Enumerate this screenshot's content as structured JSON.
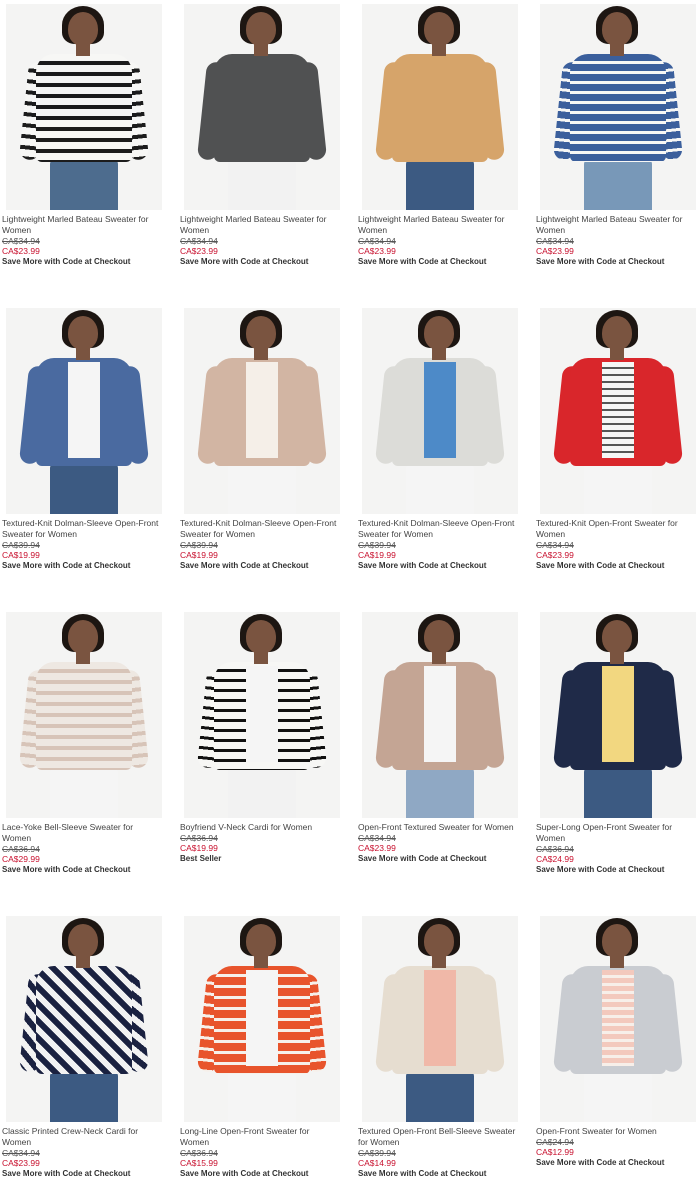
{
  "products": [
    {
      "name": "Lightweight Marled Bateau Sweater for Women",
      "was": "CA$34.94",
      "now": "CA$23.99",
      "promo": "Save More with Code at Checkout",
      "look": {
        "top": "stripe-black",
        "inner": "",
        "legs": "#4d6c8e"
      }
    },
    {
      "name": "Lightweight Marled Bateau Sweater for Women",
      "was": "CA$34.94",
      "now": "CA$23.99",
      "promo": "Save More with Code at Checkout",
      "look": {
        "top": "#505152",
        "inner": "",
        "legs": "#f2f2f2"
      }
    },
    {
      "name": "Lightweight Marled Bateau Sweater for Women",
      "was": "CA$34.94",
      "now": "CA$23.99",
      "promo": "Save More with Code at Checkout",
      "look": {
        "top": "#d6a46a",
        "inner": "",
        "legs": "#3c5a82"
      }
    },
    {
      "name": "Lightweight Marled Bateau Sweater for Women",
      "was": "CA$34.94",
      "now": "CA$23.99",
      "promo": "Save More with Code at Checkout",
      "look": {
        "top": "stripe-blue",
        "inner": "",
        "legs": "#7898b8"
      }
    },
    {
      "name": "Textured-Knit Dolman-Sleeve Open-Front Sweater for Women",
      "was": "CA$39.94",
      "now": "CA$19.99",
      "promo": "Save More with Code at Checkout",
      "look": {
        "top": "#4a6aa0",
        "inner": "#f5f5f5",
        "legs": "#3c5a82"
      }
    },
    {
      "name": "Textured-Knit Dolman-Sleeve Open-Front Sweater for Women",
      "was": "CA$39.94",
      "now": "CA$19.99",
      "promo": "Save More with Code at Checkout",
      "look": {
        "top": "#d2b5a3",
        "inner": "#f5efe8",
        "legs": "#f5f5f5"
      }
    },
    {
      "name": "Textured-Knit Dolman-Sleeve Open-Front Sweater for Women",
      "was": "CA$39.94",
      "now": "CA$19.99",
      "promo": "Save More with Code at Checkout",
      "look": {
        "top": "#dcdcd8",
        "inner": "#4d8ac8",
        "legs": "#f5f5f5"
      }
    },
    {
      "name": "Textured-Knit Open-Front Sweater for Women",
      "was": "CA$34.94",
      "now": "CA$23.99",
      "promo": "Save More with Code at Checkout",
      "look": {
        "top": "#d9262b",
        "inner": "stripe-gray",
        "legs": "#f5f5f5"
      }
    },
    {
      "name": "Lace-Yoke Bell-Sleeve Sweater for Women",
      "was": "CA$36.94",
      "now": "CA$29.99",
      "promo": "Save More with Code at Checkout",
      "look": {
        "top": "stripe-pink",
        "inner": "",
        "legs": "#f5f5f5"
      }
    },
    {
      "name": "Boyfriend V-Neck Cardi for Women",
      "was": "CA$36.94",
      "now": "CA$19.99",
      "promo": "Best Seller",
      "look": {
        "top": "stripe-bw",
        "inner": "#f5f5f5",
        "legs": "#f2f2f2"
      }
    },
    {
      "name": "Open-Front Textured Sweater for Women",
      "was": "CA$34.94",
      "now": "CA$23.99",
      "promo": "Save More with Code at Checkout",
      "look": {
        "top": "#c4a594",
        "inner": "#f5f5f5",
        "legs": "#8fa8c4"
      }
    },
    {
      "name": "Super-Long Open-Front Sweater for Women",
      "was": "CA$36.94",
      "now": "CA$24.99",
      "promo": "Save More with Code at Checkout",
      "look": {
        "top": "#1f2a48",
        "inner": "#f2d780",
        "legs": "#3c5a82"
      }
    },
    {
      "name": "Classic Printed Crew-Neck Cardi for Women",
      "was": "CA$34.94",
      "now": "CA$23.99",
      "promo": "Save More with Code at Checkout",
      "look": {
        "top": "print-navy",
        "inner": "",
        "legs": "#3c5a82"
      }
    },
    {
      "name": "Long-Line Open-Front Sweater for Women",
      "was": "CA$36.94",
      "now": "CA$15.99",
      "promo": "Save More with Code at Checkout",
      "look": {
        "top": "stripe-orange",
        "inner": "#f5f5f5",
        "legs": "#f5f5f5"
      }
    },
    {
      "name": "Textured Open-Front Bell-Sleeve Sweater for Women",
      "was": "CA$39.94",
      "now": "CA$14.99",
      "promo": "Save More with Code at Checkout",
      "look": {
        "top": "#e6ddd0",
        "inner": "#f0b8a8",
        "legs": "#3c5a82"
      }
    },
    {
      "name": "Open-Front Sweater for Women",
      "was": "CA$24.94",
      "now": "CA$12.99",
      "promo": "Save More with Code at Checkout",
      "look": {
        "top": "#c9ccd1",
        "inner": "stripe-peach",
        "legs": "#f5f5f5"
      }
    }
  ]
}
